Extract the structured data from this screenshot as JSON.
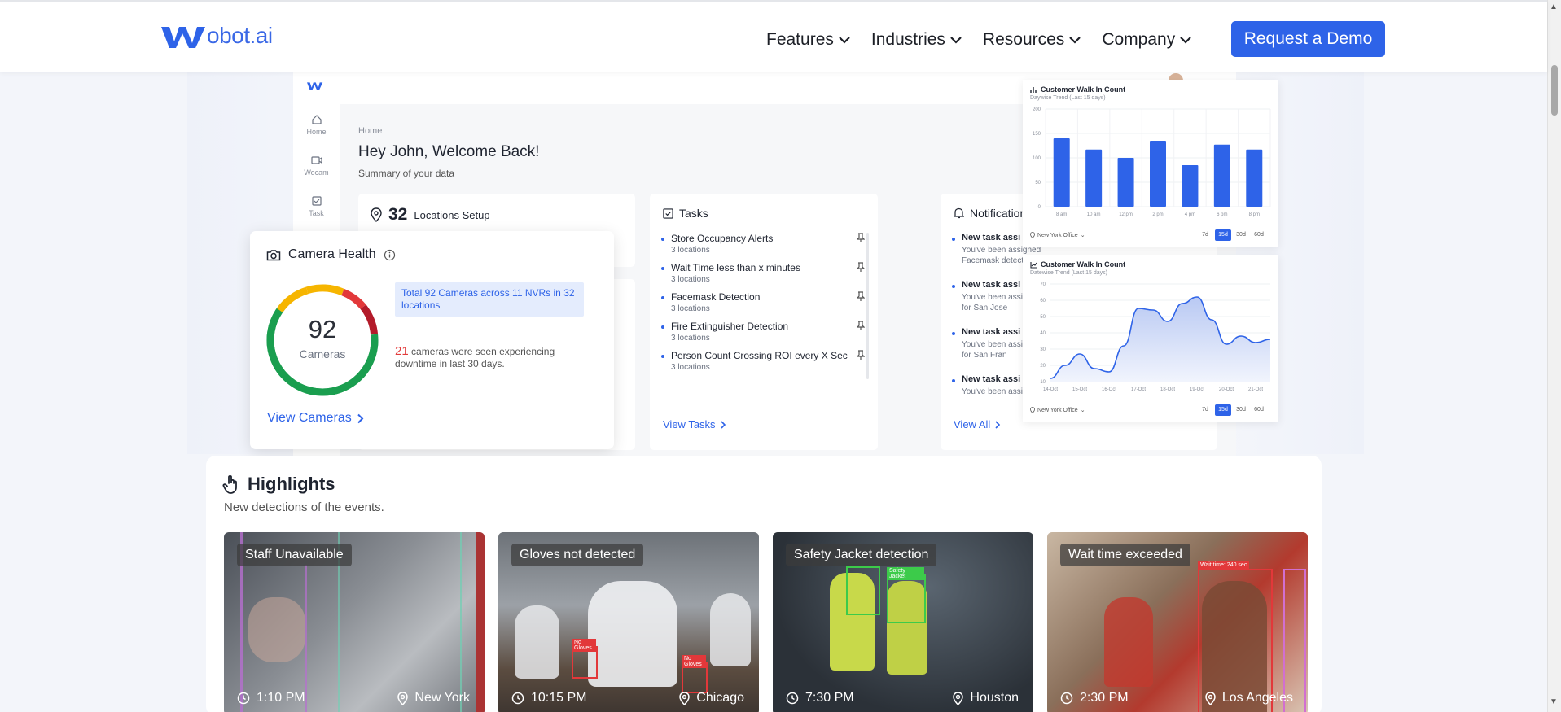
{
  "nav": {
    "logo_text": "obot.ai",
    "items": [
      {
        "label": "Features"
      },
      {
        "label": "Industries"
      },
      {
        "label": "Resources"
      },
      {
        "label": "Company"
      }
    ],
    "cta_label": "Request a Demo",
    "brand_color": "#2e63e8"
  },
  "dashboard": {
    "sidebar": [
      {
        "label": "Home",
        "icon": "home-icon"
      },
      {
        "label": "Wocam",
        "icon": "video-icon"
      },
      {
        "label": "Task",
        "icon": "checkbox-icon"
      }
    ],
    "breadcrumb": "Home",
    "welcome": "Hey John, Welcome Back!",
    "summary": "Summary of your data",
    "locations": {
      "count": "32",
      "label": "Locations Setup"
    },
    "tasks": {
      "title": "Tasks",
      "items": [
        {
          "name": "Store Occupancy Alerts",
          "sub": "3 locations"
        },
        {
          "name": "Wait Time less than x minutes",
          "sub": "3 locations"
        },
        {
          "name": "Facemask Detection",
          "sub": "3 locations"
        },
        {
          "name": "Fire Extinguisher Detection",
          "sub": "3 locations"
        },
        {
          "name": "Person Count Crossing ROI every X Sec",
          "sub": "3 locations"
        }
      ],
      "link": "View Tasks"
    },
    "notifications": {
      "title": "Notification",
      "items": [
        {
          "title": "New task assi",
          "text": "You've been assigned Facemask detection task forNew York"
        },
        {
          "title": "New task assi",
          "text": "You've been assi task for San Jose"
        },
        {
          "title": "New task assi",
          "text": "You've been assi task for San Fran"
        },
        {
          "title": "New task assi",
          "text": "You've been assi"
        }
      ],
      "link": "View All"
    }
  },
  "camera_health": {
    "title": "Camera Health",
    "count": "92",
    "count_label": "Cameras",
    "info": "Total 92 Cameras across 11 NVRs in 32 locations",
    "down_count": "21",
    "down_text": "cameras were seen experiencing downtime in last 30 days.",
    "link": "View Cameras"
  },
  "charts": {
    "bar": {
      "title": "Customer Walk In Count",
      "subtitle": "Daywise Trend (Last 15 days)",
      "location": "New York Office",
      "ranges": [
        "7d",
        "15d",
        "30d",
        "60d"
      ],
      "active_range": "15d"
    },
    "area": {
      "title": "Customer Walk In Count",
      "subtitle": "Datewise Trend (Last 15 days)",
      "location": "New York Office",
      "ranges": [
        "7d",
        "15d",
        "30d",
        "60d"
      ],
      "active_range": "15d"
    }
  },
  "chart_data": [
    {
      "type": "bar",
      "title": "Customer Walk In Count",
      "subtitle": "Daywise Trend (Last 15 days)",
      "categories": [
        "8 am",
        "10 am",
        "12 pm",
        "2 pm",
        "4 pm",
        "6 pm",
        "8 pm"
      ],
      "values": [
        140,
        117,
        100,
        135,
        85,
        127,
        117
      ],
      "yticks": [
        0,
        50,
        100,
        150,
        200
      ],
      "ylim": [
        0,
        200
      ],
      "color": "#2e63e8"
    },
    {
      "type": "area",
      "title": "Customer Walk In Count",
      "subtitle": "Datewise Trend (Last 15 days)",
      "categories": [
        "14-Oct",
        "15-Oct",
        "16-Oct",
        "17-Oct",
        "18-Oct",
        "19-Oct",
        "20-Oct",
        "21-Oct"
      ],
      "x": [
        0,
        0.5,
        1,
        1.5,
        2,
        2.5,
        3,
        3.5,
        4,
        4.5,
        5,
        5.5,
        6,
        6.5,
        7,
        7.5
      ],
      "values": [
        12,
        20,
        27,
        18,
        16,
        32,
        55,
        54,
        47,
        58,
        62,
        48,
        33,
        38,
        34,
        36
      ],
      "yticks": [
        10,
        20,
        30,
        40,
        50,
        60,
        70
      ],
      "ylim": [
        10,
        70
      ],
      "color": "#2e63e8"
    }
  ],
  "highlights": {
    "title": "Highlights",
    "subtitle": "New detections of the events.",
    "items": [
      {
        "tag": "Staff Unavailable",
        "time": "1:10 PM",
        "location": "New York"
      },
      {
        "tag": "Gloves not detected",
        "time": "10:15 PM",
        "location": "Chicago"
      },
      {
        "tag": "Safety Jacket detection",
        "time": "7:30 PM",
        "location": "Houston"
      },
      {
        "tag": "Wait time exceeded",
        "time": "2:30 PM",
        "location": "Los Angeles"
      }
    ],
    "overlays": {
      "no_gloves": "No Gloves",
      "safety_jacket": "Safety Jacket",
      "wait_time": "Wait time: 240 sec"
    }
  }
}
